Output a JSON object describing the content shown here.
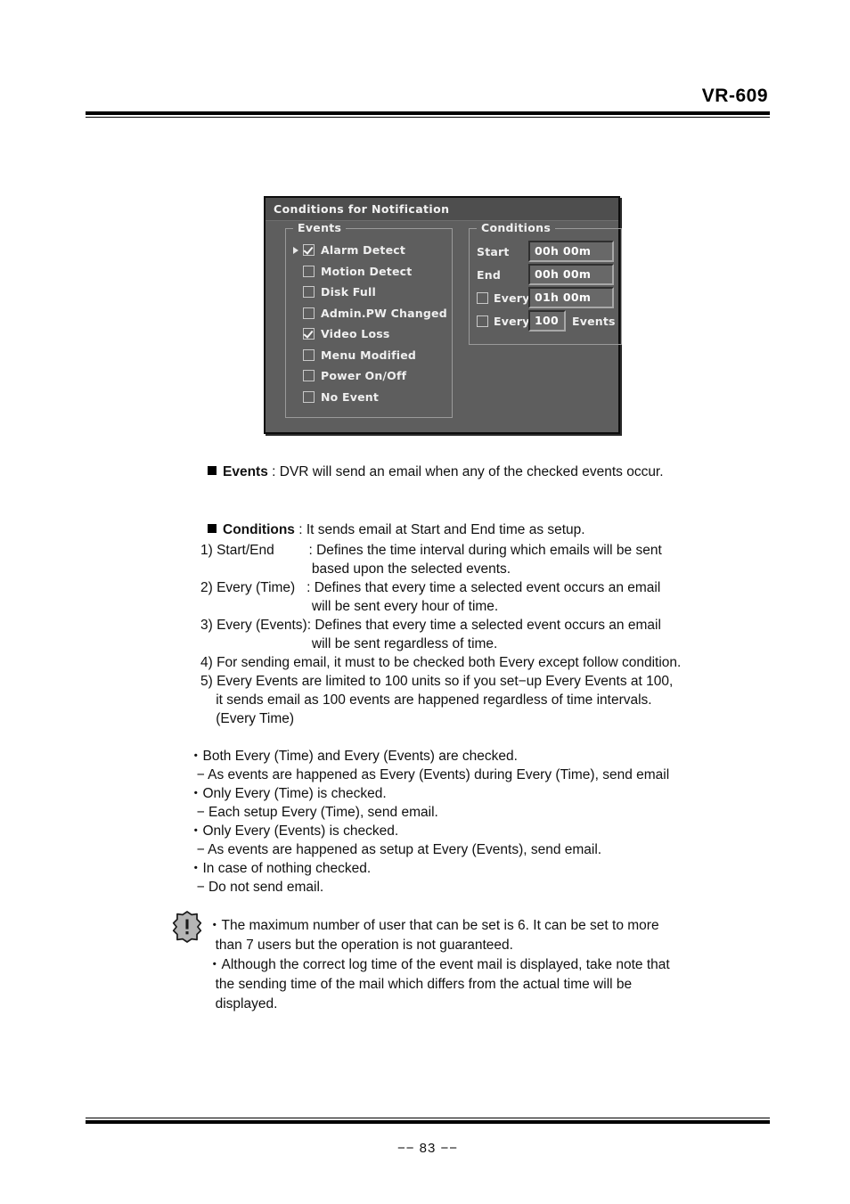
{
  "header": {
    "model": "VR-609"
  },
  "dialog": {
    "title": "Conditions for Notification",
    "events_group": {
      "legend": "Events",
      "items": [
        {
          "label": "Alarm Detect",
          "checked": true,
          "cursor": true
        },
        {
          "label": "Motion Detect",
          "checked": false,
          "cursor": false
        },
        {
          "label": "Disk Full",
          "checked": false,
          "cursor": false
        },
        {
          "label": "Admin.PW Changed",
          "checked": false,
          "cursor": false
        },
        {
          "label": "Video Loss",
          "checked": true,
          "cursor": false
        },
        {
          "label": "Menu Modified",
          "checked": false,
          "cursor": false
        },
        {
          "label": "Power On/Off",
          "checked": false,
          "cursor": false
        },
        {
          "label": "No Event",
          "checked": false,
          "cursor": false
        }
      ]
    },
    "conditions_group": {
      "legend": "Conditions",
      "start_label": "Start",
      "start_value": "00h 00m",
      "end_label": "End",
      "end_value": "00h 00m",
      "every_time_label": "Every",
      "every_time_value": "01h 00m",
      "every_time_checked": false,
      "every_events_label": "Every",
      "every_events_value": "100",
      "every_events_unit": "Events",
      "every_events_checked": false
    },
    "colors": {
      "body": "#5e5e5e",
      "titlebar": "#4e4e4e",
      "field": "#686868",
      "text": "#efefef"
    }
  },
  "body": {
    "events_line": {
      "term": "Events",
      "rest": " : DVR will send an email when any of the checked events occur."
    },
    "conditions_line": {
      "term": "Conditions",
      "rest": " : It sends email at Start and End time as setup."
    },
    "numbered": [
      "1) Start/End         : Defines the time interval during which emails will be sent",
      "                             based upon the selected events.",
      "2) Every (Time)   : Defines that every time a selected event occurs an email",
      "                             will be sent every hour of time.",
      "3) Every (Events): Defines that every time a selected event occurs an email",
      "                             will be sent regardless of time.",
      "4) For sending email, it must to be checked both Every except follow condition.",
      "5) Every Events are limited to 100 units so if you set−up Every Events at 100,",
      "    it sends email as 100 events are happened regardless of time intervals.",
      "    (Every Time)"
    ],
    "bullets": [
      "・Both Every (Time) and Every (Events) are checked.",
      "  − As events are happened as Every (Events) during Every (Time), send email",
      "・Only Every (Time) is checked.",
      "  − Each setup Every (Time), send email.",
      "・Only Every (Events) is checked.",
      "  − As events are happened as setup at Every (Events), send email.",
      "・In case of nothing checked.",
      "  − Do not send email."
    ],
    "note": [
      "・The maximum number of user that can be set is 6. It can be set to more",
      "  than 7 users but the operation is not guaranteed.",
      "・Although the correct log time of the event mail is displayed, take note that",
      "  the sending time of the mail which differs from the actual time will be",
      "  displayed."
    ]
  },
  "footer": {
    "page_number": "−− 83 −−"
  }
}
